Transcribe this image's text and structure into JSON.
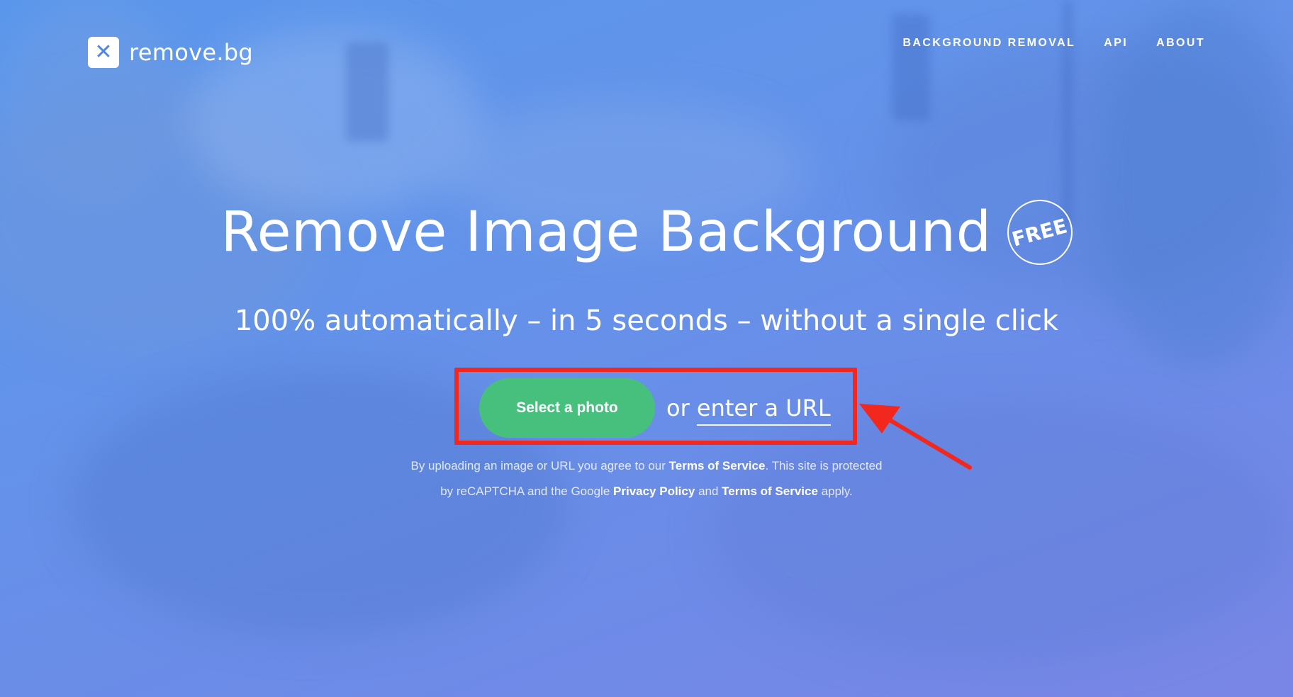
{
  "brand": {
    "name": "remove.bg",
    "logo_glyph": "✕",
    "accent": "#4f85e3"
  },
  "nav": {
    "items": [
      {
        "label": "BACKGROUND REMOVAL"
      },
      {
        "label": "API"
      },
      {
        "label": "ABOUT"
      }
    ]
  },
  "hero": {
    "title": "Remove Image Background",
    "badge": "FREE",
    "subtitle": "100% automatically – in 5 seconds – without a single click",
    "cta": {
      "label": "Select a photo",
      "color": "#48c07d"
    },
    "or_text": "or",
    "url_link": "enter a URL"
  },
  "legal": {
    "part1": "By uploading an image or URL you agree to our",
    "tos1": "Terms of Service",
    "part2": ". This site is protected",
    "part3": "by reCAPTCHA and the Google",
    "privacy": "Privacy Policy",
    "part4": "and",
    "tos2": "Terms of Service",
    "part5": "apply."
  },
  "annotation": {
    "color": "#f2271e",
    "shape": "arrow pointing to highlighted upload controls"
  }
}
